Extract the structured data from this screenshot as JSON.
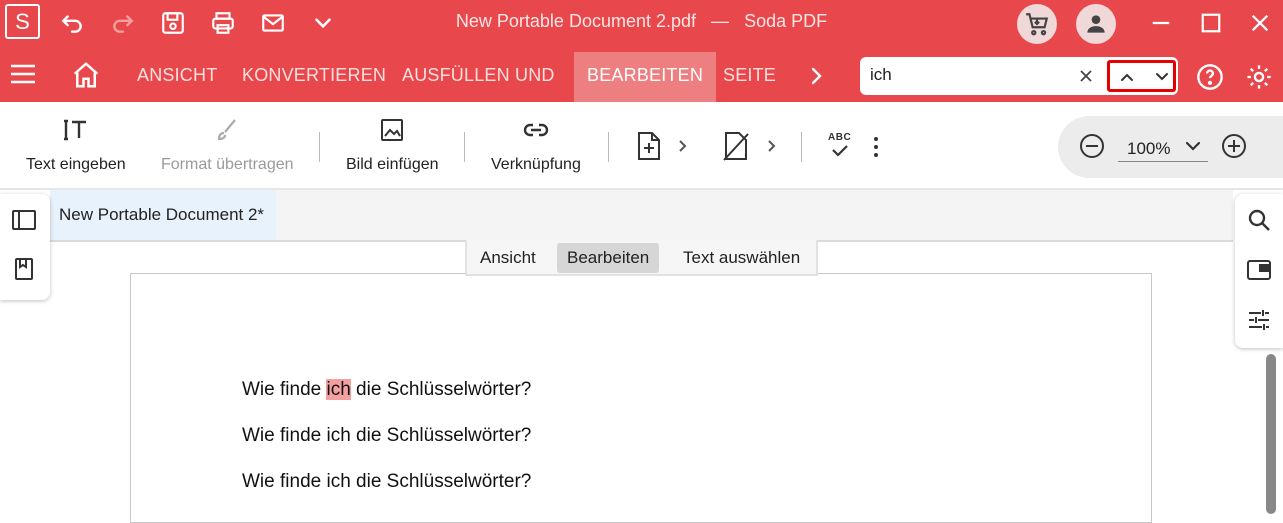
{
  "app": {
    "logo_letter": "S",
    "doc_title": "New Portable Document 2.pdf",
    "title_separator": "—",
    "app_name": "Soda PDF"
  },
  "quick_access": {
    "icons": [
      "undo-icon",
      "redo-icon",
      "save-icon",
      "print-icon",
      "mail-icon",
      "chevron-down-icon"
    ]
  },
  "ribbon_tabs": [
    {
      "label": "ANSICHT"
    },
    {
      "label": "KONVERTIEREN"
    },
    {
      "label": "AUSFÜLLEN UND"
    },
    {
      "label": "BEARBEITEN",
      "active": true
    },
    {
      "label": "SEITE"
    }
  ],
  "search": {
    "value": "ich",
    "placeholder": ""
  },
  "toolbar": {
    "text_input": "Text eingeben",
    "format_transfer": "Format übertragen",
    "insert_image": "Bild einfügen",
    "link": "Verknüpfung",
    "spellcheck_label": "ABC"
  },
  "zoom": {
    "value": "100%"
  },
  "document": {
    "tab_label": "New Portable Document 2*",
    "modes": [
      "Ansicht",
      "Bearbeiten",
      "Text auswählen"
    ],
    "active_mode": "Bearbeiten",
    "lines": [
      {
        "before": "Wie finde ",
        "match": "ich",
        "after": " die Schlüsselwörter?"
      },
      {
        "text": "Wie finde ich die Schlüsselwörter?"
      },
      {
        "text": "Wie finde ich die Schlüsselwörter?"
      }
    ]
  },
  "colors": {
    "brand": "#e8474b",
    "active_tab": "#ee7f81",
    "highlight": "#f4a0a0",
    "search_nav_border": "#e60000"
  }
}
